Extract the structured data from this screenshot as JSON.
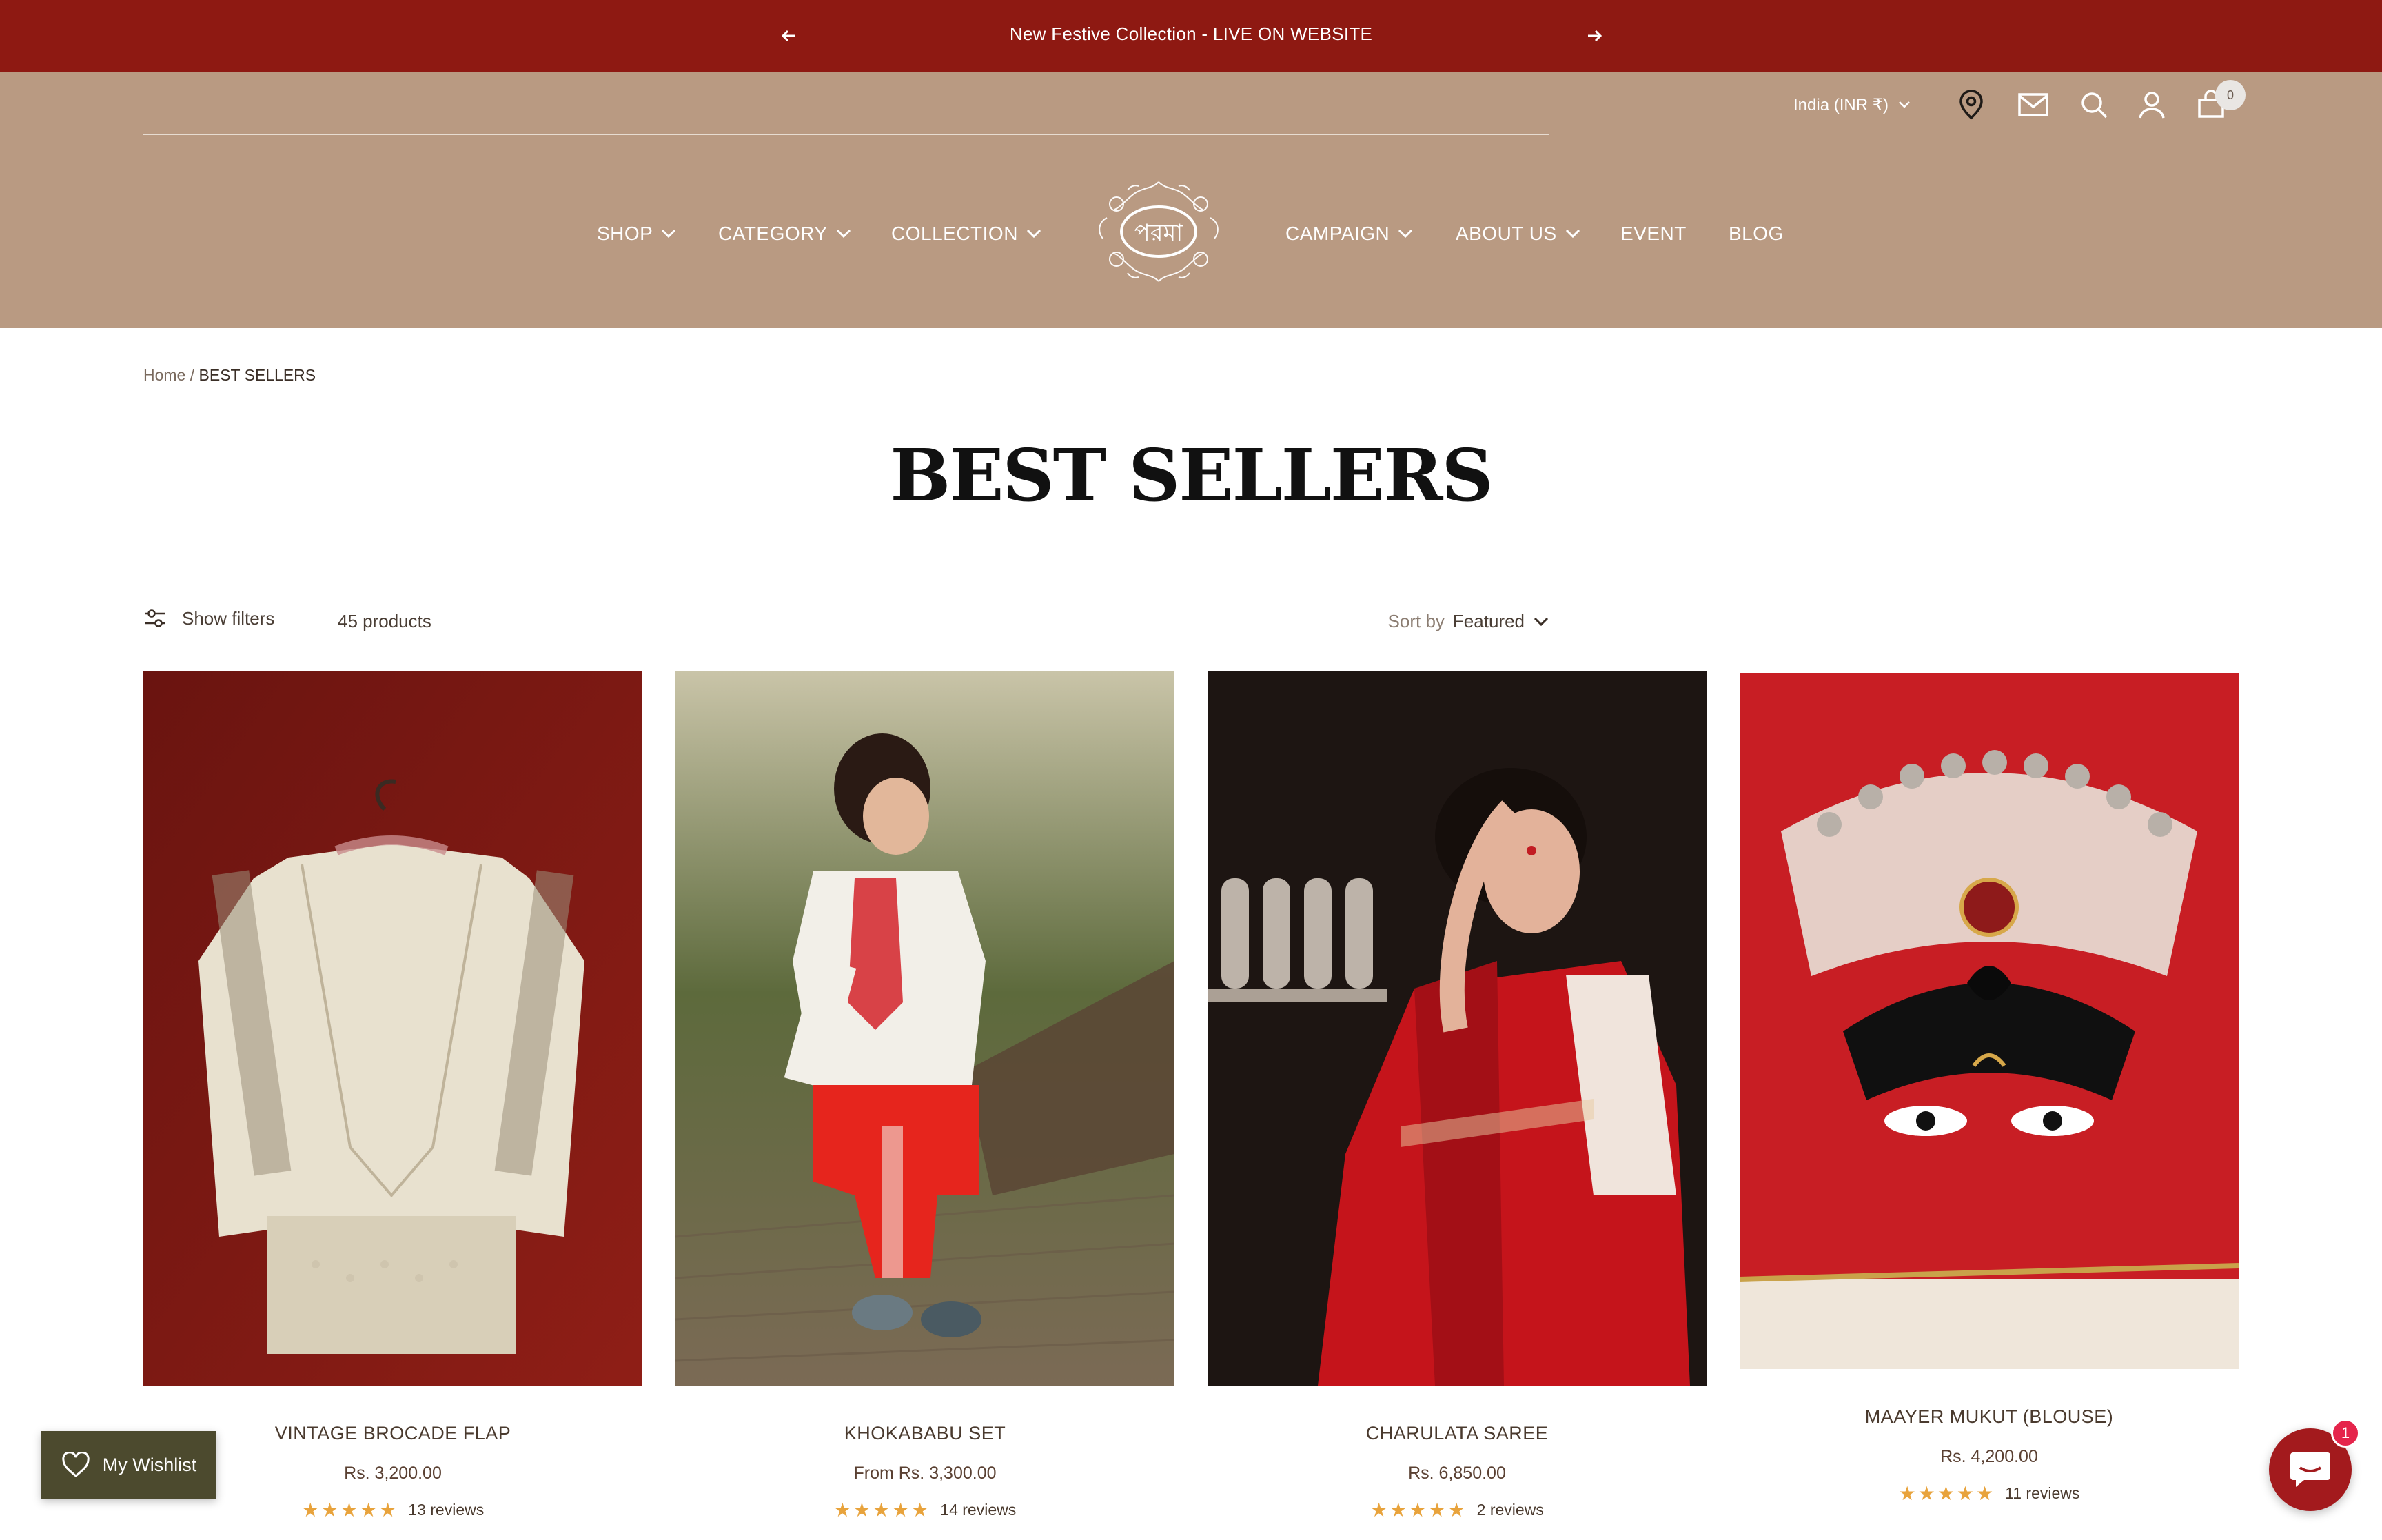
{
  "announcement": {
    "text": "New Festive Collection - LIVE ON WEBSITE",
    "prev_icon": "arrow-left-icon",
    "next_icon": "arrow-right-icon"
  },
  "header": {
    "locale": "India (INR ₹)",
    "icons": [
      "location-pin-icon",
      "mail-icon",
      "search-icon",
      "account-icon",
      "cart-icon"
    ],
    "cart_count": "0",
    "logo_text": "পরমা",
    "nav_left": [
      {
        "label": "SHOP",
        "dropdown": true
      },
      {
        "label": "CATEGORY",
        "dropdown": true
      },
      {
        "label": "COLLECTION",
        "dropdown": true
      }
    ],
    "nav_right": [
      {
        "label": "CAMPAIGN",
        "dropdown": true
      },
      {
        "label": "ABOUT US",
        "dropdown": true
      },
      {
        "label": "EVENT",
        "dropdown": false
      },
      {
        "label": "BLOG",
        "dropdown": false
      }
    ],
    "background": "#b99a82"
  },
  "breadcrumb": {
    "home": "Home",
    "separator": "/",
    "current": "BEST SELLERS"
  },
  "page_title": "BEST SELLERS",
  "toolbar": {
    "show_filters": "Show filters",
    "count": "45 products",
    "sort_label": "Sort by",
    "sort_value": "Featured"
  },
  "products": [
    {
      "name": "VINTAGE BROCADE FLAP",
      "price": "Rs. 3,200.00",
      "stars": "★★★★★",
      "reviews": "13 reviews"
    },
    {
      "name": "KHOKABABU SET",
      "price": "From Rs. 3,300.00",
      "stars": "★★★★★",
      "reviews": "14 reviews"
    },
    {
      "name": "CHARULATA SAREE",
      "price": "Rs. 6,850.00",
      "stars": "★★★★★",
      "reviews": "2 reviews"
    },
    {
      "name": "MAAYER MUKUT (BLOUSE)",
      "price": "Rs. 4,200.00",
      "stars": "★★★★★",
      "reviews": "11 reviews"
    }
  ],
  "wishlist": {
    "label": "My Wishlist"
  },
  "chat": {
    "badge": "1"
  },
  "colors": {
    "announcement": "#8e1912",
    "header": "#b99a82",
    "star": "#e8a33c",
    "wishlist": "#4c4a2e",
    "chat": "#a31a1d"
  }
}
